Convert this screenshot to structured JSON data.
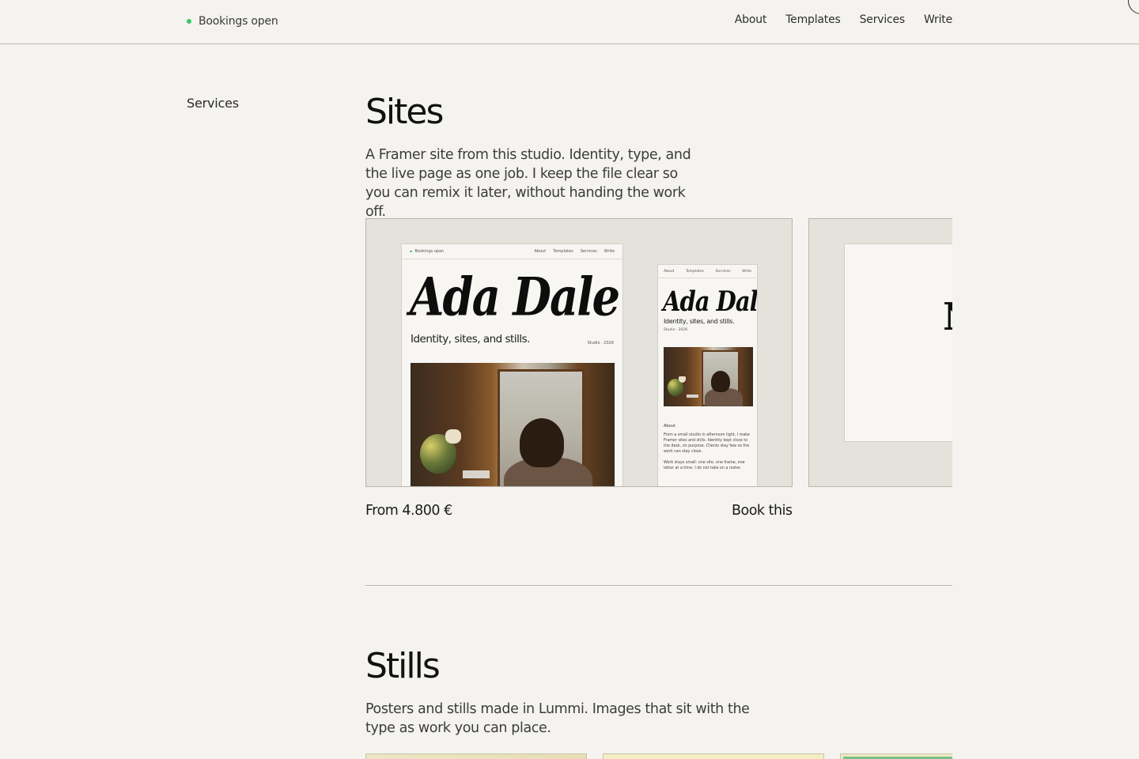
{
  "header": {
    "status_label": "Bookings open",
    "status_color": "#3cc56a",
    "nav": [
      "About",
      "Templates",
      "Services",
      "Write"
    ]
  },
  "side_label": "Services",
  "sites": {
    "title": "Sites",
    "description": "A Framer site from this studio. Identity, type, and the live page as one job. I keep the file clear so you can remix it later, without handing the work off.",
    "price": "From 4.800 €",
    "cta": "Book this",
    "preview": {
      "status_label": "Bookings open",
      "nav": [
        "About",
        "Templates",
        "Services",
        "Write"
      ],
      "name": "Ada Dale",
      "tagline": "Identity, sites, and stills.",
      "year": "Studio · 2026",
      "about_heading": "About",
      "about_p1": "From a small studio in afternoon light, I make Framer sites and stills. Identity kept close to the desk, on purpose. Clients stay few so the work can stay close.",
      "about_p2": "Work stays small: one site, one frame, one letter at a time. I do not take on a roster."
    },
    "next_card_glyph": "N"
  },
  "stills": {
    "title": "Stills",
    "description": "Posters and stills made in Lummi. Images that sit with the type as work you can place."
  }
}
